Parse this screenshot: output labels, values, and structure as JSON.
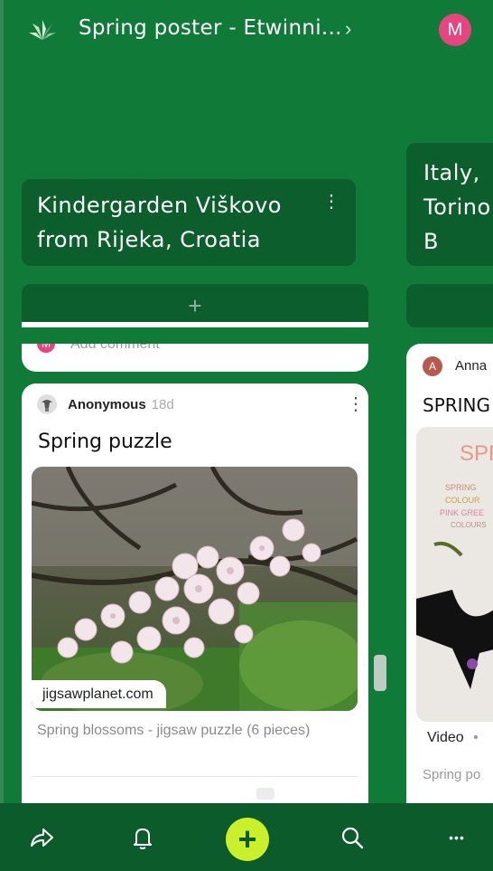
{
  "header": {
    "title": "Spring poster - Etwinni...",
    "chevron": "›",
    "user_initial": "M",
    "logo_icon": "padlet-logo-icon"
  },
  "columns": [
    {
      "title_line1": "Kindergarden Viškovo",
      "title_line2": "from Rijeka, Croatia",
      "add_label": "+",
      "comment_placeholder": "Add comment",
      "comment_avatar_initial": "M",
      "post": {
        "author": "Anonymous",
        "time": "18d",
        "title": "Spring puzzle",
        "link_domain": "jigsawplanet.com",
        "link_description": "Spring blossoms - jigsaw puzzle (6 pieces)"
      }
    },
    {
      "title_line1": "Italy,",
      "title_line2": "Torino",
      "title_line3": "B",
      "post": {
        "author_initial": "A",
        "author": "Anna",
        "title": "SPRING",
        "badge": "Video",
        "badge_sep": "•",
        "caption": "Spring po",
        "drawing_texts": [
          "SPR",
          "SPRING",
          "COLOUR",
          "PINK GREE",
          "COLOURS"
        ]
      }
    }
  ],
  "bottom_nav": {
    "items": [
      "share-icon",
      "bell-icon",
      "add-post-icon",
      "search-icon",
      "more-icon"
    ],
    "compose_plus": "+",
    "more_dots": "•••"
  },
  "colors": {
    "background": "#107a39",
    "column_header": "#0c5e2d",
    "compose": "#c9f02b",
    "avatar_m": "#e64580",
    "avatar_a": "#b55a4e"
  }
}
